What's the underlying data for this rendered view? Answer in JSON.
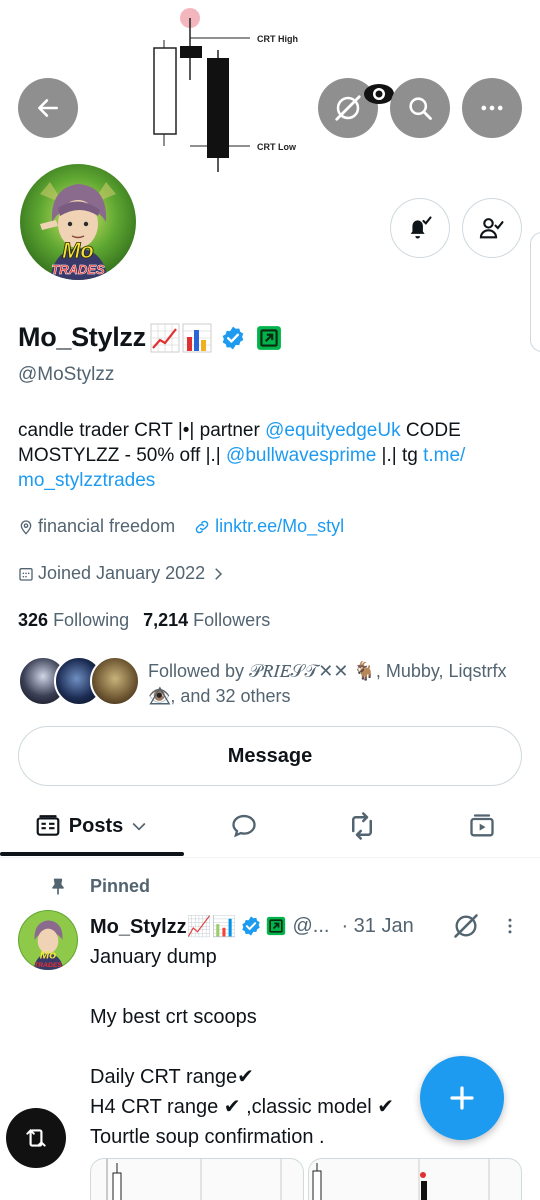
{
  "banner": {
    "label_high": "CRT High",
    "label_low": "CRT Low"
  },
  "top_actions": {
    "back": "arrow-left-icon",
    "grok": "grok-slash-icon",
    "search": "search-icon",
    "more": "more-horizontal-icon"
  },
  "avatar": {
    "line1": "Mo",
    "line2": "TRADES"
  },
  "profile": {
    "display_name": "Mo_Stylzz",
    "name_emoji": "chart-increasing-emoji, bar-chart-emoji",
    "verified": "verified-badge-icon",
    "affiliate": "affiliate-badge-icon",
    "handle": "@MoStylzz",
    "bio_text1": "candle trader CRT |•| partner ",
    "bio_link1": "@equityedgeUk",
    "bio_text2": " CODE MOSTYLZZ - 50% off |.| ",
    "bio_link2": "@bullwavesprime",
    "bio_text3": " |.| tg ",
    "bio_link3": "t.me/​mo_stylzztrades",
    "location": "financial freedom",
    "website": "linktr.ee/Mo_styl",
    "joined": "Joined January 2022",
    "following_count": "326",
    "following_label": "Following",
    "followers_count": "7,214",
    "followers_label": "Followers",
    "followed_by_text1": "Followed by ",
    "followed_by_name1": "𝒫𝑅𝐼𝐸𝒮𝒯✕✕ 🐐",
    "followed_by_text2": ", Mubby, Liqstrfx 👁️⃤, and 32 others",
    "message_label": "Message"
  },
  "tabs": {
    "posts_label": "Posts",
    "replies_icon": "speech-bubble-icon",
    "reposts_icon": "repost-icon",
    "media_icon": "media-icon"
  },
  "post": {
    "pinned_label": "Pinned",
    "name": "Mo_Stylzz📈📊",
    "handle": "@...",
    "date": "· 31 Jan",
    "body": "January dump\n\nMy best crt scoops\n\nDaily CRT range✔\nH4 CRT  range ✔ ,classic model ✔\nTourtle soup confirmation ."
  },
  "colors": {
    "accent": "#1d9bf0",
    "text": "#0f1419",
    "muted": "#536471",
    "border": "#cfd9de",
    "overlay_button": "#8f8f8f",
    "affiliate": "#00b34a"
  }
}
